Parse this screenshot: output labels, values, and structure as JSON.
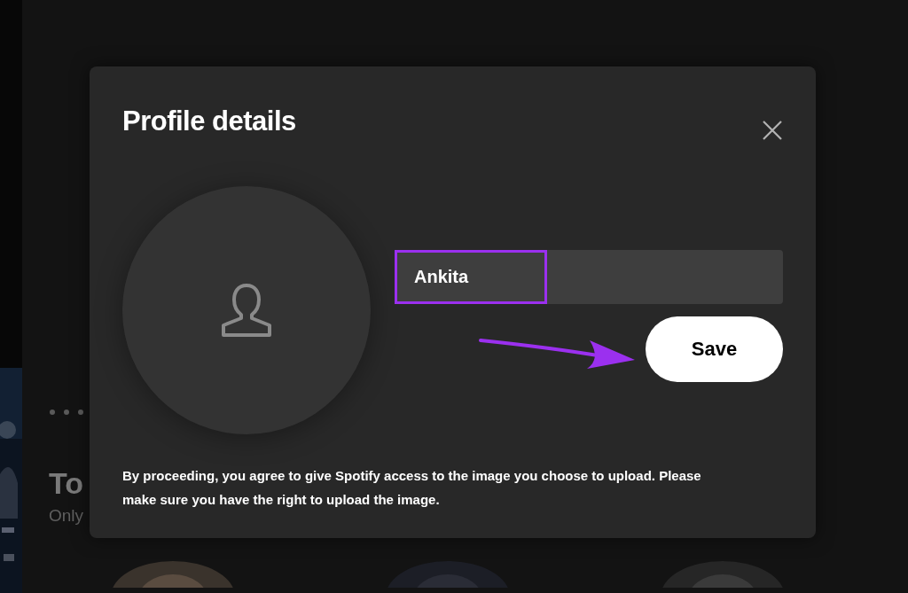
{
  "background": {
    "heading": "To",
    "subtitle": "Only"
  },
  "dialog": {
    "title": "Profile details",
    "name_field": {
      "value": "Ankita"
    },
    "save_button": "Save",
    "disclaimer": "By proceeding, you agree to give Spotify access to the image you choose to upload. Please make sure you have the right to upload the image."
  }
}
